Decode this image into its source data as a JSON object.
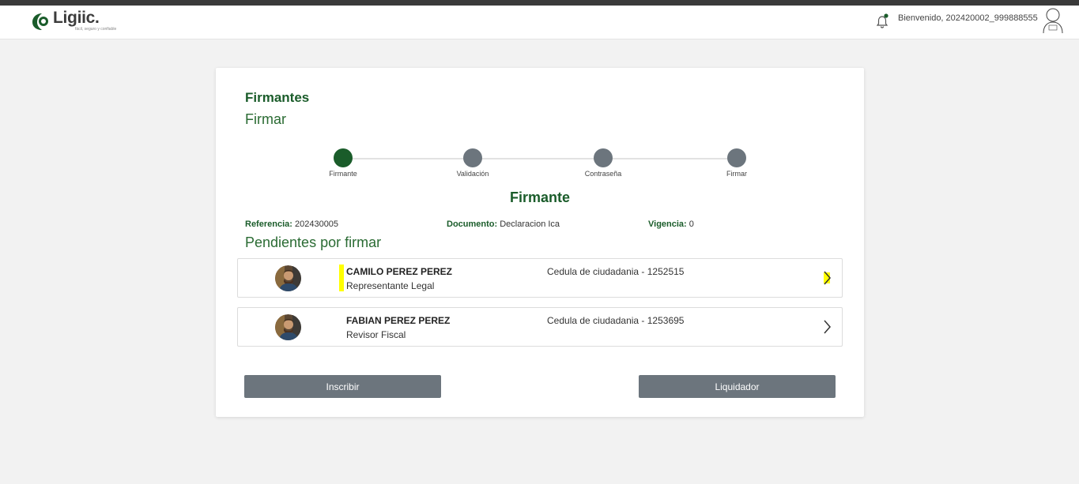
{
  "header": {
    "logo_text": "Ligiic.",
    "logo_tagline": "fácil, seguro y confiable",
    "welcome_text": "Bienvenido, 202420002_999888555",
    "icons": [
      "bell-icon",
      "user-avatar-icon"
    ]
  },
  "card": {
    "title": "Firmantes",
    "subtitle": "Firmar",
    "steps": [
      {
        "label": "Firmante",
        "active": true
      },
      {
        "label": "Validación",
        "active": false
      },
      {
        "label": "Contraseña",
        "active": false
      },
      {
        "label": "Firmar",
        "active": false
      }
    ],
    "section_title": "Firmante",
    "meta": {
      "referencia_label": "Referencia:",
      "referencia_value": "202430005",
      "documento_label": "Documento:",
      "documento_value": "Declaracion Ica",
      "vigencia_label": "Vigencia:",
      "vigencia_value": "0"
    },
    "pending_title": "Pendientes por firmar",
    "signers": [
      {
        "name": "CAMILO PEREZ PEREZ",
        "role": "Representante Legal",
        "doc": "Cedula de ciudadania - 1252515",
        "highlighted": true
      },
      {
        "name": "FABIAN PEREZ PEREZ",
        "role": "Revisor Fiscal",
        "doc": "Cedula de ciudadania - 1253695",
        "highlighted": false
      }
    ],
    "buttons": {
      "inscribir": "Inscribir",
      "liquidador": "Liquidador"
    }
  },
  "colors": {
    "brand_green": "#1a5c2a",
    "step_inactive": "#6c757d",
    "highlight": "#ffff00",
    "button": "#6c757d"
  }
}
